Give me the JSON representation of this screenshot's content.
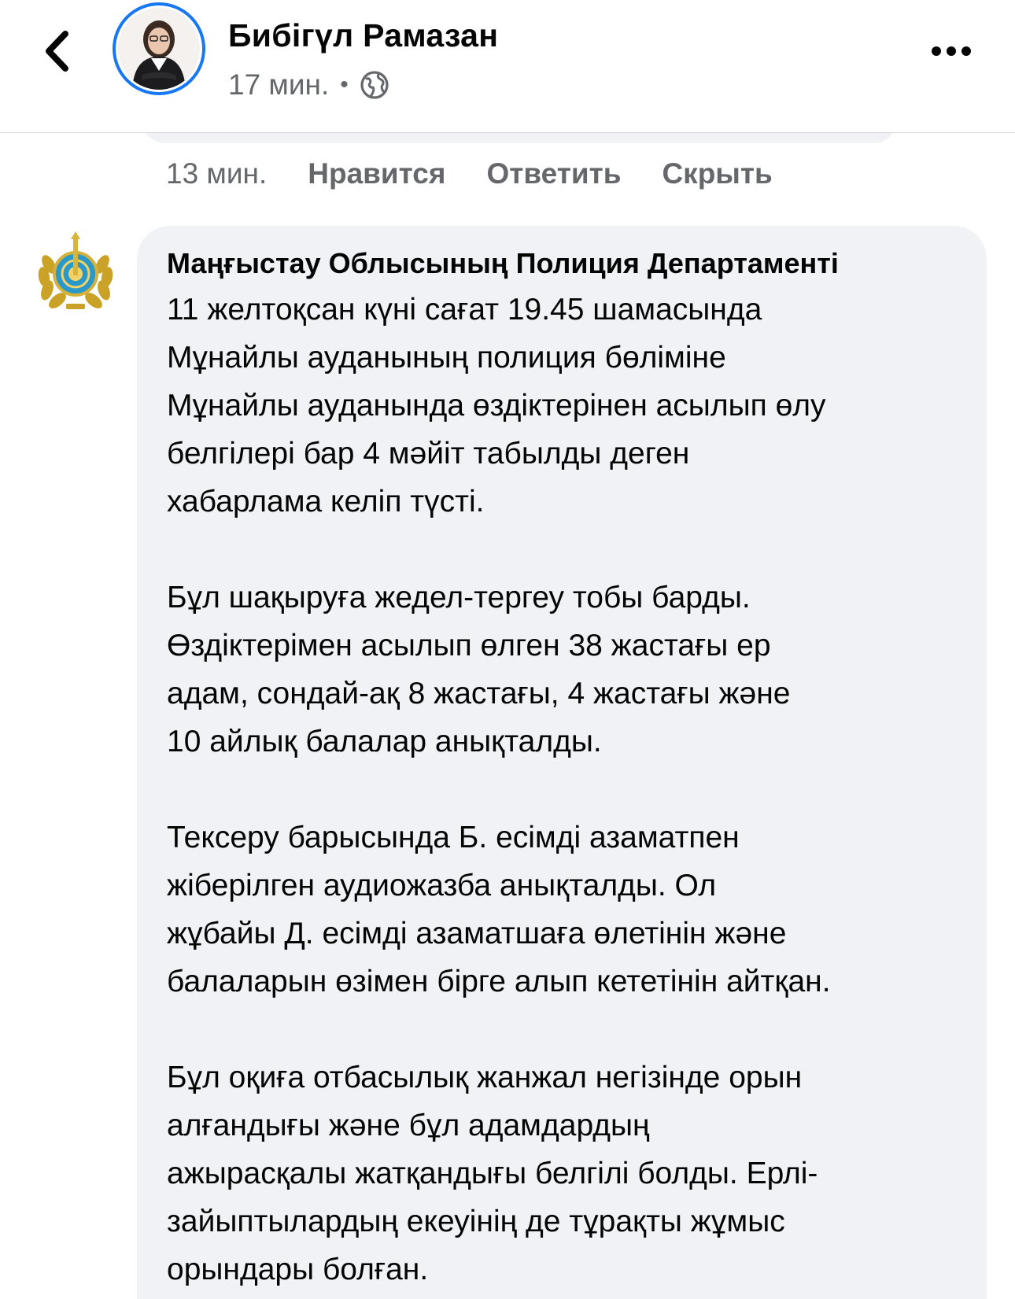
{
  "header": {
    "author_name": "Бибігүл Рамазан",
    "post_time": "17 мин.",
    "meta_separator": "•",
    "privacy_icon": "globe-icon",
    "back_icon": "chevron-left-icon",
    "more_icon": "more-dots-icon"
  },
  "comment_actions": {
    "time": "13 мин.",
    "like_label": "Нравится",
    "reply_label": "Ответить",
    "hide_label": "Скрыть"
  },
  "comment": {
    "author": "Маңғыстау Облысының Полиция Департаменті",
    "avatar_icon": "police-emblem-icon",
    "paragraphs": [
      "11 желтоқсан күні сағат 19.45 шамасында\nМұнайлы ауданының полиция бөліміне\nМұнайлы ауданында өздіктерінен асылып өлу\nбелгілері бар 4 мәйіт табылды деген\nхабарлама келіп түсті.",
      "Бұл шақыруға жедел-тергеу тобы барды.\nӨздіктерімен асылып өлген 38 жастағы ер\nадам, сондай-ақ 8 жастағы, 4 жастағы және\n10 айлық балалар анықталды.",
      "Тексеру барысында Б. есімді азаматпен\nжіберілген аудиожазба анықталды. Ол\nжұбайы Д. есімді азаматшаға өлетінін және\nбалаларын өзімен бірге алып кететінін айтқан.",
      "Бұл оқиға отбасылық жанжал негізінде орын\nалғандығы және бұл адамдардың\nажырасқалы жатқандығы белгілі болды. Ерлі-\nзайыптылардың екеуінің де тұрақты жұмыс\nорындары болған."
    ]
  },
  "colors": {
    "accent": "#1877f2",
    "bubble": "#f0f2f5",
    "secondary_text": "#65676b",
    "primary_text": "#050505"
  }
}
